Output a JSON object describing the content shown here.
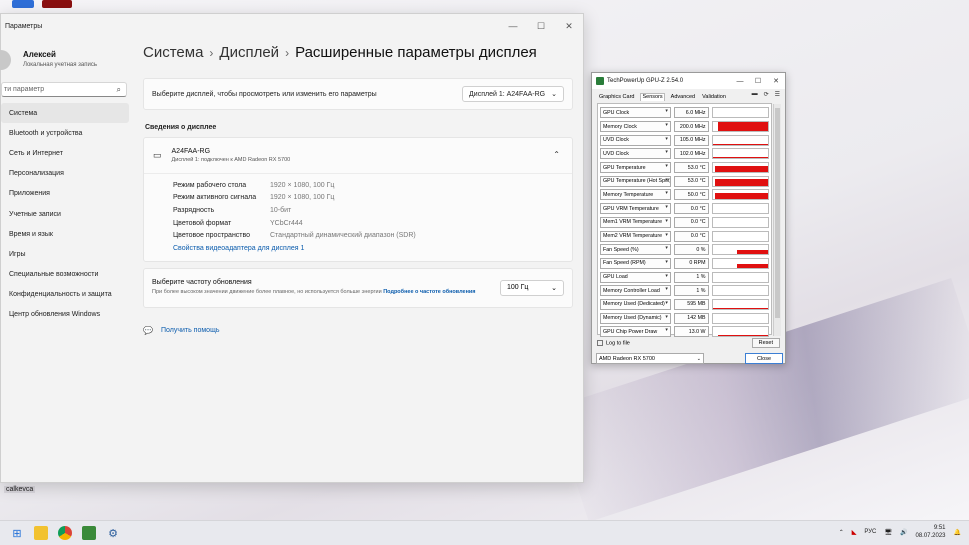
{
  "settings": {
    "window_title": "Параметры",
    "user": {
      "name": "Алексей",
      "type": "Локальная учетная запись"
    },
    "search_placeholder": "ти параметр",
    "nav": [
      "Система",
      "Bluetooth и устройства",
      "Сеть и Интернет",
      "Персонализация",
      "Приложения",
      "Учетные записи",
      "Время и язык",
      "Игры",
      "Специальные возможности",
      "Конфиденциальность и защита",
      "Центр обновления Windows"
    ],
    "breadcrumb": [
      "Система",
      "Дисплей",
      "Расширенные параметры дисплея"
    ],
    "select_display_text": "Выберите дисплей, чтобы просмотреть или изменить его параметры",
    "display_dropdown": "Дисплей 1: A24FAA-RG",
    "section_title": "Сведения о дисплее",
    "monitor": {
      "name": "A24FAA-RG",
      "sub": "Дисплей 1: подключен к AMD Radeon RX 5700"
    },
    "props": [
      {
        "k": "Режим рабочего стола",
        "v": "1920 × 1080, 100 Гц"
      },
      {
        "k": "Режим активного сигнала",
        "v": "1920 × 1080, 100 Гц"
      },
      {
        "k": "Разрядность",
        "v": "10-бит"
      },
      {
        "k": "Цветовой формат",
        "v": "YCbCr444"
      },
      {
        "k": "Цветовое пространство",
        "v": "Стандартный динамический диапазон (SDR)"
      }
    ],
    "adapter_link": "Свойства видеоадаптера для дисплея 1",
    "refresh": {
      "title": "Выберите частоту обновления",
      "desc": "При более высоком значении движение более плавное, но используется больше энергии",
      "link": "Подробнее о частоте обновления",
      "value": "100 Гц"
    },
    "help": "Получить помощь"
  },
  "gpuz": {
    "title": "TechPowerUp GPU-Z 2.54.0",
    "tabs": [
      "Graphics Card",
      "Sensors",
      "Advanced",
      "Validation"
    ],
    "sensors": [
      {
        "name": "GPU Clock",
        "value": "6.0 MHz",
        "level": 0.05,
        "width": 0
      },
      {
        "name": "Memory Clock",
        "value": "200.0 MHz",
        "level": 0.8,
        "width": 0.9
      },
      {
        "name": "UVD Clock",
        "value": "105.0 MHz",
        "level": 0.05,
        "width": 1
      },
      {
        "name": "UVD Clock",
        "value": "102.0 MHz",
        "level": 0.05,
        "width": 1
      },
      {
        "name": "GPU Temperature",
        "value": "53.0 °C",
        "level": 0.6,
        "width": 0.95
      },
      {
        "name": "GPU Temperature (Hot Spot)",
        "value": "53.0 °C",
        "level": 0.6,
        "width": 0.95
      },
      {
        "name": "Memory Temperature",
        "value": "50.0 °C",
        "level": 0.6,
        "width": 0.95
      },
      {
        "name": "GPU VRM Temperature",
        "value": "0.0 °C",
        "level": 0,
        "width": 0
      },
      {
        "name": "Mem1 VRM Temperature",
        "value": "0.0 °C",
        "level": 0,
        "width": 0
      },
      {
        "name": "Mem2 VRM Temperature",
        "value": "0.0 °C",
        "level": 0,
        "width": 0
      },
      {
        "name": "Fan Speed (%)",
        "value": "0 %",
        "level": 0.35,
        "width": 0.55
      },
      {
        "name": "Fan Speed (RPM)",
        "value": "0 RPM",
        "level": 0.4,
        "width": 0.55
      },
      {
        "name": "GPU Load",
        "value": "1 %",
        "level": 0.05,
        "width": 0
      },
      {
        "name": "Memory Controller Load",
        "value": "1 %",
        "level": 0.05,
        "width": 0
      },
      {
        "name": "Memory Used (Dedicated)",
        "value": "595 MB",
        "level": 0.05,
        "width": 1
      },
      {
        "name": "Memory Used (Dynamic)",
        "value": "142 MB",
        "level": 0.05,
        "width": 0
      },
      {
        "name": "GPU Chip Power Draw",
        "value": "13.0 W",
        "level": 0.15,
        "width": 0.9
      }
    ],
    "log_label": "Log to file",
    "reset_label": "Reset",
    "adapter": "AMD Radeon RX 5700",
    "close_label": "Close"
  },
  "desktop_label": "calkevca",
  "taskbar": {
    "lang": "РУС",
    "time": "9:51",
    "date": "08.07.2023"
  },
  "colors": {
    "accent": "#0b5cad",
    "graph": "#e01010"
  }
}
